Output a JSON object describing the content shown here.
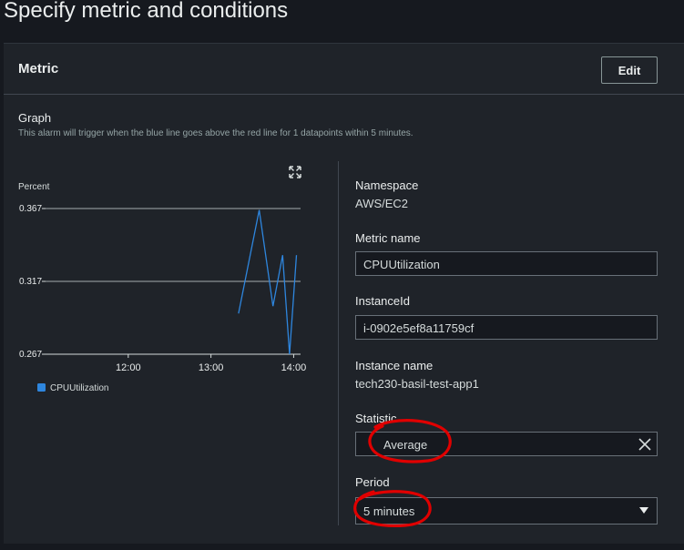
{
  "page": {
    "title": "Specify metric and conditions"
  },
  "metric_panel": {
    "heading": "Metric",
    "edit_label": "Edit"
  },
  "graph": {
    "title": "Graph",
    "description": "This alarm will trigger when the blue line goes above the red line for 1 datapoints within 5 minutes.",
    "expand_icon": "expand-icon"
  },
  "chart_data": {
    "type": "line",
    "ylabel": "Percent",
    "y_ticks": [
      "0.367",
      "0.317",
      "0.267"
    ],
    "ylim": [
      0.267,
      0.367
    ],
    "x_ticks": [
      "12:00",
      "13:00",
      "14:00"
    ],
    "xlim": [
      "11:00",
      "14:05"
    ],
    "legend": "bottom-left",
    "series": [
      {
        "name": "CPUUtilization",
        "color": "#2e86de",
        "x": [
          "13:20",
          "13:35",
          "13:45",
          "13:52",
          "13:57",
          "14:02"
        ],
        "values": [
          0.295,
          0.366,
          0.3,
          0.335,
          0.267,
          0.335
        ]
      }
    ]
  },
  "details": {
    "namespace_label": "Namespace",
    "namespace_value": "AWS/EC2",
    "metric_name_label": "Metric name",
    "metric_name_value": "CPUUtilization",
    "instance_id_label": "InstanceId",
    "instance_id_value": "i-0902e5ef8a11759cf",
    "instance_name_label": "Instance name",
    "instance_name_value": "tech230-basil-test-app1",
    "statistic_label": "Statistic",
    "statistic_value": "Average",
    "period_label": "Period",
    "period_value": "5 minutes"
  },
  "colors": {
    "annotation": "#e00000",
    "series": "#2e86de"
  }
}
